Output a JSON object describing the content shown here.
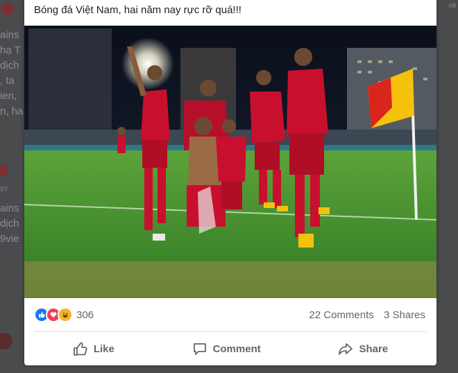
{
  "background": {
    "left_fragments": [
      "ains",
      "hạ T",
      "dịch",
      ", ta",
      "ien,",
      "n, ha",
      "ST",
      "ains",
      "dịch",
      "9vie"
    ],
    "right_fragment": "ok"
  },
  "post": {
    "text": "Bóng đá Việt Nam, hai năm nay rực rỡ quá!!!",
    "reactions": {
      "icons": [
        "like-icon",
        "love-icon",
        "haha-icon"
      ],
      "count": "306"
    },
    "comments": "22 Comments",
    "shares": "3 Shares",
    "actions": {
      "like": "Like",
      "comment": "Comment",
      "share": "Share"
    }
  },
  "colors": {
    "facebook_blue": "#1877f2",
    "love_red": "#f33e58",
    "haha_yellow": "#f7b125",
    "kit_red": "#c8102e",
    "pitch_green": "#3f8f2e"
  }
}
